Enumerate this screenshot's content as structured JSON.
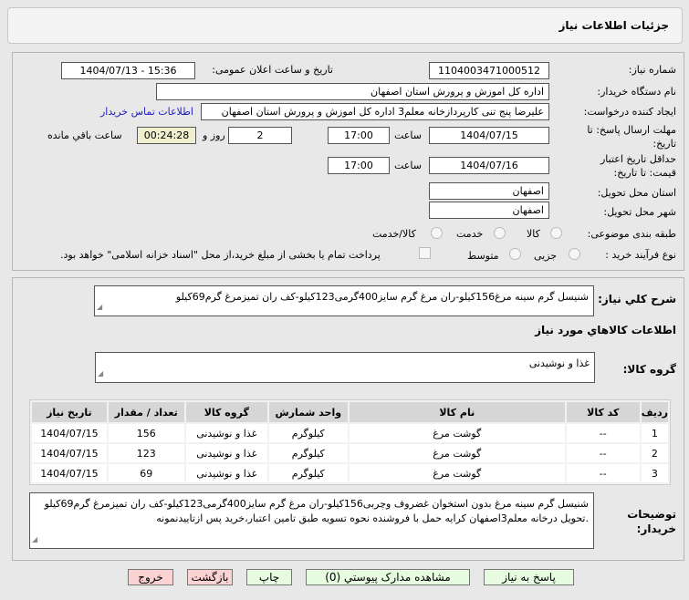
{
  "header": {
    "title": "جزئیات اطلاعات نیاز"
  },
  "form": {
    "need_number_label": "شماره نیاز:",
    "need_number": "1104003471000512",
    "announce_label": "تاریخ و ساعت اعلان عمومی:",
    "announce_value": "1404/07/13 - 15:36",
    "buyer_label": "نام دستگاه خریدار:",
    "buyer": "اداره کل اموزش و پرورش استان اصفهان",
    "creator_label": "ایجاد کننده درخواست:",
    "creator": "علیرضا پنج تنی کارپردازخانه معلم3 اداره کل اموزش و پرورش استان اصفهان",
    "contact_link": "اطلاعات تماس خریدار",
    "deadline_label_1": "مهلت ارسال پاسخ: تا",
    "deadline_label_2": "تاریخ:",
    "deadline_date": "1404/07/15",
    "time_label": "ساعت",
    "deadline_time": "17:00",
    "days": "2",
    "days_label": "روز و",
    "remaining": "00:24:28",
    "remaining_label": "ساعت باقي مانده",
    "validity_label_1": "حداقل تاریخ اعتبار",
    "validity_label_2": "قیمت: تا تاریخ:",
    "validity_date": "1404/07/16",
    "validity_time": "17:00",
    "province_label": "استان محل تحویل:",
    "province": "اصفهان",
    "city_label": "شهر محل تحویل:",
    "city": "اصفهان",
    "category_label": "طبقه بندی موضوعی:",
    "category_options": [
      "کالا",
      "خدمت",
      "کالا/خدمت"
    ],
    "process_label": "نوع فرآیند خرید :",
    "process_options": [
      "جزیی",
      "متوسط"
    ],
    "payment_note": "پرداخت تمام یا بخشی از مبلغ خرید،از محل \"اسناد خزانه اسلامی\" خواهد بود."
  },
  "details": {
    "summary_label": "شرح کلي نياز:",
    "summary": "شنیسل گرم سینه مرغ156کیلو-ران مرغ گرم سایز400گرمی123کیلو-کف ران تمیزمرغ گرم69کیلو",
    "goods_heading": "اطلاعات کالاهاي مورد نياز",
    "group_label": "گروه کالا:",
    "group": "غذا و نوشیدنی",
    "table": {
      "headers": [
        "ردیف",
        "کد کالا",
        "نام کالا",
        "واحد شمارش",
        "گروه کالا",
        "تعداد / مقدار",
        "تاریخ نیاز"
      ],
      "rows": [
        [
          "1",
          "--",
          "گوشت مرغ",
          "کیلوگرم",
          "غذا و نوشیدنی",
          "156",
          "1404/07/15"
        ],
        [
          "2",
          "--",
          "گوشت مرغ",
          "کیلوگرم",
          "غذا و نوشیدنی",
          "123",
          "1404/07/15"
        ],
        [
          "3",
          "--",
          "گوشت مرغ",
          "کیلوگرم",
          "غذا و نوشیدنی",
          "69",
          "1404/07/15"
        ]
      ]
    },
    "notes_label_1": "توضیحات",
    "notes_label_2": "خریدار:",
    "notes": "شنیسل گرم سینه مرغ بدون استخوان غضروف وچربی156کیلو-ران مرغ گرم سایز400گرمی123کیلو-کف ران تمیزمرغ گرم69کیلو .تحویل درخانه معلم3اصفهان کرایه حمل با فروشنده نحوه تسویه طبق تامین اعتبار،خرید پس ازتاییدنمونه"
  },
  "buttons": {
    "reply": "پاسخ به نیاز",
    "attachments": "مشاهده مدارک پیوستي (0)",
    "print": "چاپ",
    "back": "بازگشت",
    "exit": "خروج"
  }
}
